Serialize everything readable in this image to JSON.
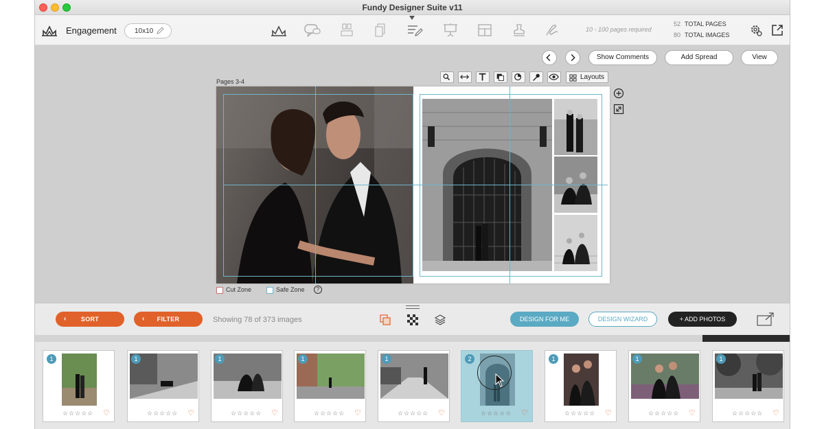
{
  "window": {
    "title": "Fundy Designer Suite v11"
  },
  "toolbar": {
    "project_name": "Engagement",
    "size": "10x10",
    "pages_required": "10 - 100 pages required",
    "total_pages_count": "52",
    "total_pages_label": "TOTAL PAGES",
    "total_images_count": "80",
    "total_images_label": "TOTAL IMAGES",
    "modes": [
      "album-icon",
      "chat-icon",
      "wall-icon",
      "cards-icon",
      "edit-icon",
      "presentation-icon",
      "layout-icon",
      "stamp-icon",
      "sign-icon"
    ],
    "active_mode_index": 4
  },
  "nav": {
    "show_comments": "Show Comments",
    "add_spread": "Add Spread",
    "view": "View"
  },
  "editor": {
    "pages_label": "Pages 3-4",
    "layouts_label": "Layouts",
    "cut_zone": "Cut Zone",
    "safe_zone": "Safe Zone",
    "help": "?"
  },
  "actions": {
    "sort": "SORT",
    "filter": "FILTER",
    "showing": "Showing 78 of 373 images",
    "design_for_me": "DESIGN FOR ME",
    "design_wizard": "DESIGN WIZARD",
    "add_photos": "+ ADD PHOTOS"
  },
  "filmstrip": [
    {
      "badge": "1",
      "stars": "☆☆☆☆☆",
      "selected": false
    },
    {
      "badge": "1",
      "stars": "☆☆☆☆☆",
      "selected": false
    },
    {
      "badge": "1",
      "stars": "☆☆☆☆☆",
      "selected": false
    },
    {
      "badge": "1",
      "stars": "☆☆☆☆☆",
      "selected": false
    },
    {
      "badge": "1",
      "stars": "☆☆☆☆☆",
      "selected": false
    },
    {
      "badge": "2",
      "stars": "☆☆☆☆☆",
      "selected": true
    },
    {
      "badge": "1",
      "stars": "☆☆☆☆☆",
      "selected": false
    },
    {
      "badge": "1",
      "stars": "☆☆☆☆☆",
      "selected": false
    },
    {
      "badge": "1",
      "stars": "☆☆☆☆☆",
      "selected": false
    }
  ],
  "colors": {
    "accent_orange": "#e0622a",
    "accent_teal": "#5aaac3",
    "badge_blue": "#4d9bb8",
    "guide_line": "#6fb5c9"
  }
}
